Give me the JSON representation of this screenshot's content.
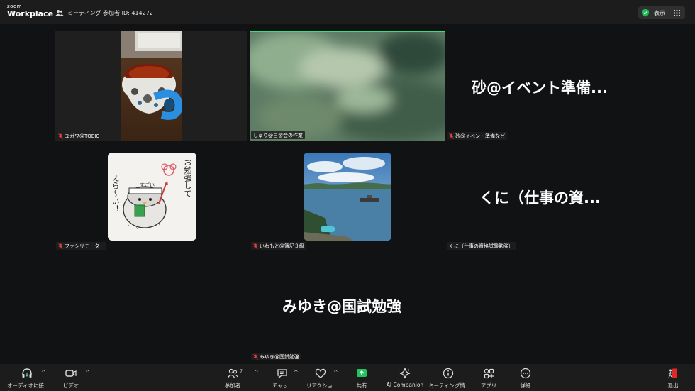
{
  "app": {
    "logo_line1": "zoom",
    "logo_line2": "Workplace"
  },
  "header": {
    "meeting_info": "ミーティング 参加者 ID: 414272",
    "view_label": "表示"
  },
  "tiles": {
    "t1": {
      "name": "ユガワ@TOEIC"
    },
    "t2": {
      "name": "しゅり@自習会の作業"
    },
    "t3": {
      "name": "砂@イベント準備など",
      "display_name": "砂@イベント準備..."
    },
    "t4": {
      "name": "ファシリテーター"
    },
    "t5": {
      "name": "いわもと@簿記３級"
    },
    "t6": {
      "name": "くに（仕事の資格試験勉強）",
      "display_name": "くに（仕事の資..."
    },
    "t7": {
      "name": "みゆき@国試勉強",
      "display_name": "みゆき@国試勉強"
    }
  },
  "sticker": {
    "text_right": "お勉強して",
    "text_left": "えら〜い！",
    "text_head": "すごい"
  },
  "toolbar": {
    "audio": "オーディオに接続",
    "video": "ビデオ",
    "participants": "参加者",
    "participants_count": "7",
    "chat": "チャット",
    "reactions": "リアクション",
    "share": "共有",
    "ai": "AI Companion",
    "info": "ミーティング情報",
    "apps": "アプリ",
    "more": "詳細",
    "leave": "退出"
  },
  "colors": {
    "active_speaker": "#3ddc84",
    "share": "#21c55d",
    "leave": "#e02828",
    "shield": "#1db954"
  }
}
